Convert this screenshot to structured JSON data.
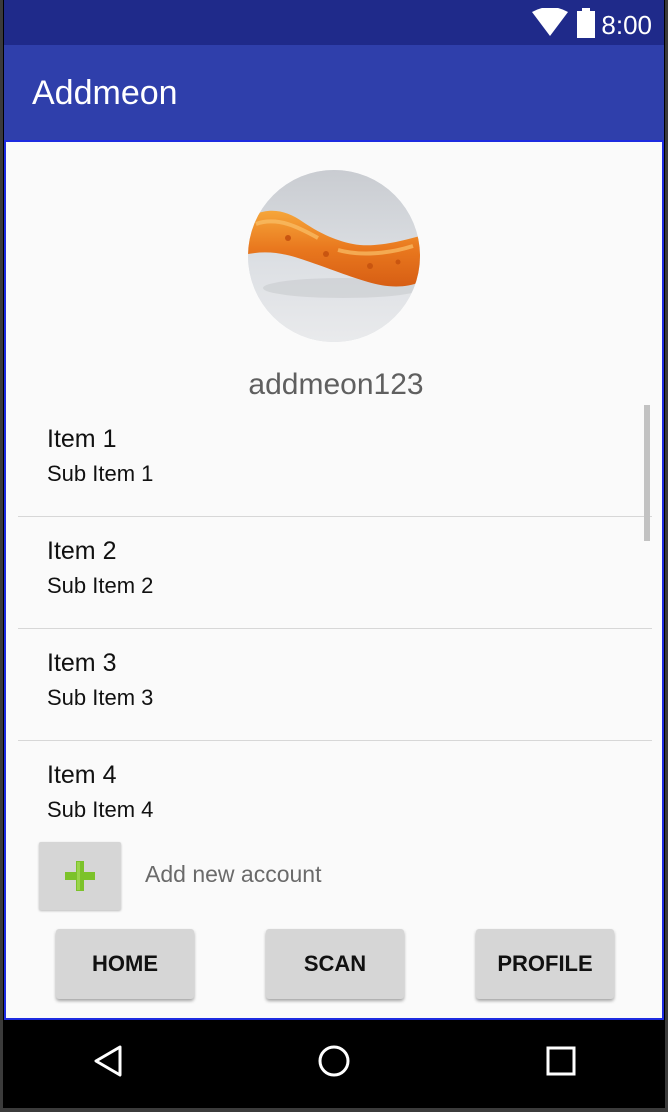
{
  "status_bar": {
    "time": "8:00",
    "icons": [
      "wifi-icon",
      "battery-icon"
    ]
  },
  "app_bar": {
    "title": "Addmeon"
  },
  "profile": {
    "avatar": "avatar-photo",
    "username": "addmeon123"
  },
  "list": {
    "items": [
      {
        "title": "Item 1",
        "subtitle": "Sub Item 1"
      },
      {
        "title": "Item 2",
        "subtitle": "Sub Item 2"
      },
      {
        "title": "Item 3",
        "subtitle": "Sub Item 3"
      },
      {
        "title": "Item 4",
        "subtitle": "Sub Item 4"
      }
    ]
  },
  "add_account": {
    "icon": "plus-icon",
    "label": "Add new account"
  },
  "bottom_nav": {
    "home": "HOME",
    "scan": "SCAN",
    "profile": "PROFILE"
  },
  "system_nav": {
    "icons": [
      "back-icon",
      "home-icon",
      "recents-icon"
    ]
  },
  "colors": {
    "status_bar": "#1f2a8a",
    "app_bar": "#2f3fab",
    "accent_plus": "#7cc22a",
    "content_bg": "#fafafa"
  }
}
